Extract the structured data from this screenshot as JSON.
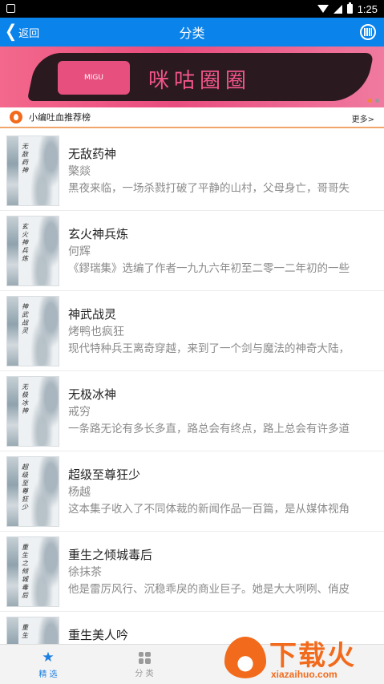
{
  "status_bar": {
    "time": "1:25"
  },
  "app_bar": {
    "back_label": "返回",
    "title": "分类"
  },
  "banner": {
    "brand_text": "咪咕圈圈",
    "logo_text": "MIGU"
  },
  "recommend": {
    "title": "小编吐血推荐榜",
    "more_label": "更多>"
  },
  "books": [
    {
      "cover_title": "无敌药神",
      "title": "无敌药神",
      "author": "檠燚",
      "desc": "黑夜来临，一场杀戮打破了平静的山村，父母身亡，哥哥失"
    },
    {
      "cover_title": "玄火神兵炼",
      "title": "玄火神兵炼",
      "author": "何辉",
      "desc": "《鏐瑞集》选编了作者一九九六年初至二零一二年初的一些"
    },
    {
      "cover_title": "神武战灵",
      "title": "神武战灵",
      "author": "烤鸭也疯狂",
      "desc": "现代特种兵王离奇穿越，来到了一个剑与魔法的神奇大陆，"
    },
    {
      "cover_title": "无极冰神",
      "title": "无极冰神",
      "author": "戒穷",
      "desc": "一条路无论有多长多直，路总会有终点，路上总会有许多道"
    },
    {
      "cover_title": "超级至尊狂少",
      "title": "超级至尊狂少",
      "author": "杨越",
      "desc": "这本集子收入了不同体裁的新闻作品一百篇，是从媒体视角"
    },
    {
      "cover_title": "重生之倾城毒后",
      "title": "重生之倾城毒后",
      "author": "徐抹茶",
      "desc": "他是雷厉风行、沉稳乖戾的商业巨子。她是大大咧咧、俏皮"
    },
    {
      "cover_title": "重生",
      "title": "重生美人吟",
      "author": "",
      "desc": ""
    }
  ],
  "tabbar": {
    "tab1_label": "精 选",
    "tab2_label": "分 类"
  },
  "watermark": {
    "text": "下载火",
    "sub": "xiazaihuo.com"
  },
  "colors": {
    "accent": "#0a83ea",
    "tab_active": "#1d7fe0",
    "watermark": "#f26a1b"
  }
}
